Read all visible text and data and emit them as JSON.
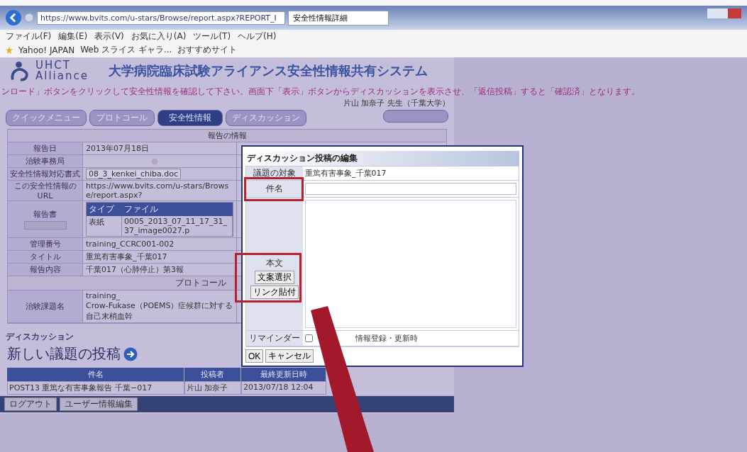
{
  "browser": {
    "address": "https://www.bvits.com/u-stars/Browse/report.aspx?REPORT_I",
    "tab_title": "安全性情報詳細",
    "menu": [
      "ファイル(F)",
      "編集(E)",
      "表示(V)",
      "お気に入り(A)",
      "ツール(T)",
      "ヘルプ(H)"
    ],
    "favorites": [
      "Yahoo! JAPAN",
      "Web スライス ギャラ...",
      "おすすめサイト"
    ]
  },
  "header": {
    "logo_top": "UHCT",
    "logo_bottom": "Alliance",
    "title": "大学病院臨床試験アライアンス安全性情報共有システム"
  },
  "notice": "ンロード」ボタンをクリックして安全性情報を確認して下さい。画面下「表示」ボタンからディスカッションを表示させ、「返信投稿」すると「確認済」となります。",
  "user": "片山 加奈子 先生（千葉大学）",
  "nav_tabs": [
    {
      "label": "クイックメニュー",
      "selected": false
    },
    {
      "label": "プロトコール",
      "selected": false
    },
    {
      "label": "安全性情報",
      "selected": true
    },
    {
      "label": "ディスカッション",
      "selected": false
    }
  ],
  "report": {
    "heading": "報告の情報",
    "rows": [
      {
        "kind": "text",
        "label": "報告日",
        "value": "2013年07月18日"
      },
      {
        "kind": "icon",
        "label": "治験事務局"
      },
      {
        "kind": "file",
        "label": "安全性情報対応書式",
        "value": "08_3_kenkei_chiba.doc"
      },
      {
        "kind": "text",
        "label": "この安全性情報のURL",
        "value": "https://www.bvits.com/u-stars/Browse/report.aspx?"
      },
      {
        "kind": "files",
        "label": "報告書",
        "columns": [
          "タイプ",
          "ファイル"
        ],
        "cells": [
          "表紙",
          "0005_2013_07_11_17_31_37_image0027.p"
        ]
      },
      {
        "kind": "text",
        "label": "管理番号",
        "value": "training_CCRC001-002"
      },
      {
        "kind": "text",
        "label": "タイトル",
        "value": "重篤有害事象_千葉017"
      },
      {
        "kind": "text",
        "label": "報告内容",
        "value": "千葉017（心肺停止）第3報"
      },
      {
        "kind": "section",
        "label": "プロトコール"
      },
      {
        "kind": "lines",
        "label": "治験課題名",
        "lines": [
          "training_",
          "Crow-Fukase（POEMS）症候群に対する自己末梢血幹"
        ]
      }
    ]
  },
  "discussion": {
    "heading": "ディスカッション",
    "new_topic": "新しい議題の投稿",
    "columns": [
      "件名",
      "投稿者",
      "最終更新日時"
    ],
    "rows": [
      [
        "POST13 重篤な有害事象報告 千葉−017",
        "片山 加奈子",
        "2013/07/18 12:04"
      ]
    ]
  },
  "footer_buttons": [
    "ログアウト",
    "ユーザー情報編集"
  ],
  "dialog": {
    "title": "ディスカッション投稿の編集",
    "target_label": "議題の対象",
    "target": "重篤有害事象_千葉017",
    "subject_label": "件名",
    "body_label": "本文",
    "body_buttons": [
      "文案選択",
      "リンク貼付"
    ],
    "reminder_label": "リマインダー",
    "reminder_checked": false,
    "reminder_text": "情報登録・更新時",
    "buttons": [
      "OK",
      "キャンセル"
    ]
  }
}
